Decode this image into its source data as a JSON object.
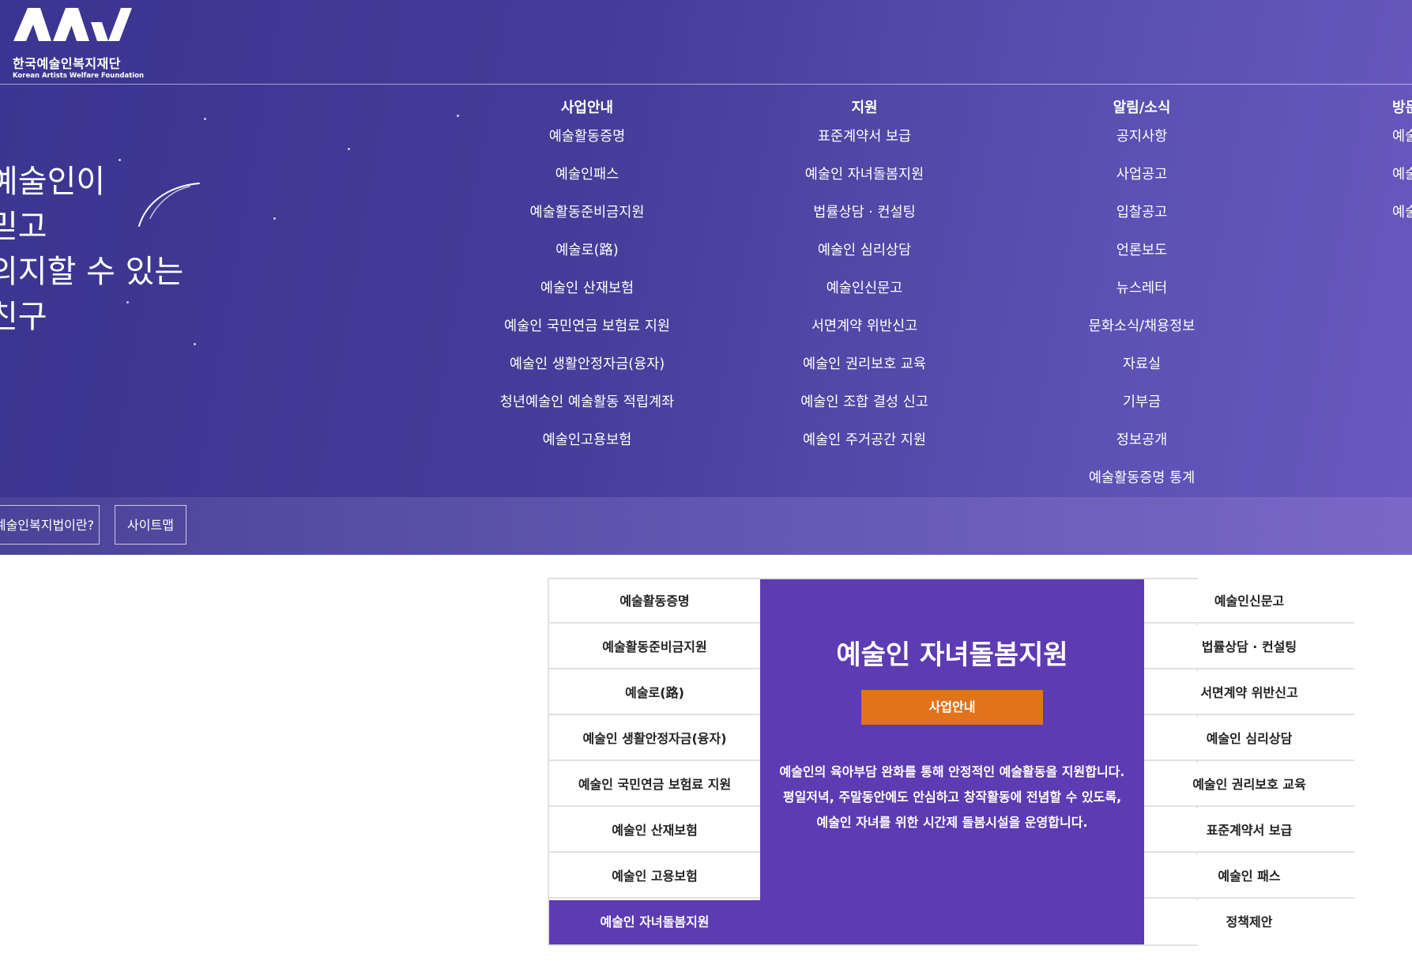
{
  "colors": {
    "hero_gradient_start": "#3a3590",
    "hero_gradient_end": "#6a58c0",
    "feature_purple": "#5d3bb3",
    "accent_orange": "#e2731b"
  },
  "header": {
    "logo_icon": "kawf-logo-icon",
    "logo_name_ko": "한국예술인복지재단",
    "logo_name_en": "Korean Artists Welfare Foundation"
  },
  "hero": {
    "slogan_lines": [
      "예술인이",
      "믿고",
      "의지할 수 있는",
      "친구"
    ]
  },
  "menu": [
    {
      "title": "사업안내",
      "items": [
        "예술활동증명",
        "예술인패스",
        "예술활동준비금지원",
        "예술로(路)",
        "예술인 산재보험",
        "예술인 국민연금 보험료 지원",
        "예술인 생활안정자금(융자)",
        "청년예술인 예술활동 적립계좌",
        "예술인고용보험"
      ]
    },
    {
      "title": "지원",
      "items": [
        "표준계약서 보급",
        "예술인 자녀돌봄지원",
        "법률상담 · 컨설팅",
        "예술인 심리상담",
        "예술인신문고",
        "서면계약 위반신고",
        "예술인 권리보호 교육",
        "예술인 조합 결성 신고",
        "예술인 주거공간 지원"
      ]
    },
    {
      "title": "알림/소식",
      "items": [
        "공지사항",
        "사업공고",
        "입찰공고",
        "언론보도",
        "뉴스레터",
        "문화소식/채용정보",
        "자료실",
        "기부금",
        "정보공개",
        "예술활동증명 통계"
      ]
    },
    {
      "title": "방문",
      "items": [
        "예술",
        "예술",
        "예술"
      ]
    }
  ],
  "subbar": {
    "law_button": "예술인복지법이란?",
    "sitemap_button": "사이트맵"
  },
  "services": {
    "left": [
      "예술활동증명",
      "예술활동준비금지원",
      "예술로(路)",
      "예술인 생활안정자금(융자)",
      "예술인 국민연금 보험료 지원",
      "예술인 산재보험",
      "예술인 고용보험",
      "예술인 자녀돌봄지원"
    ],
    "active_index": 7,
    "right": [
      "예술인신문고",
      "법률상담 · 컨설팅",
      "서면계약 위반신고",
      "예술인 심리상담",
      "예술인 권리보호 교육",
      "표준계약서 보급",
      "예술인 패스",
      "정책제안"
    ],
    "feature": {
      "title": "예술인 자녀돌봄지원",
      "button": "사업안내",
      "desc_lines": [
        "예술인의 육아부담 완화를 통해 안정적인 예술활동을 지원합니다.",
        "평일저녁, 주말동안에도 안심하고 창작활동에 전념할 수 있도록,",
        "예술인 자녀를 위한 시간제 돌봄시설을 운영합니다."
      ]
    }
  }
}
